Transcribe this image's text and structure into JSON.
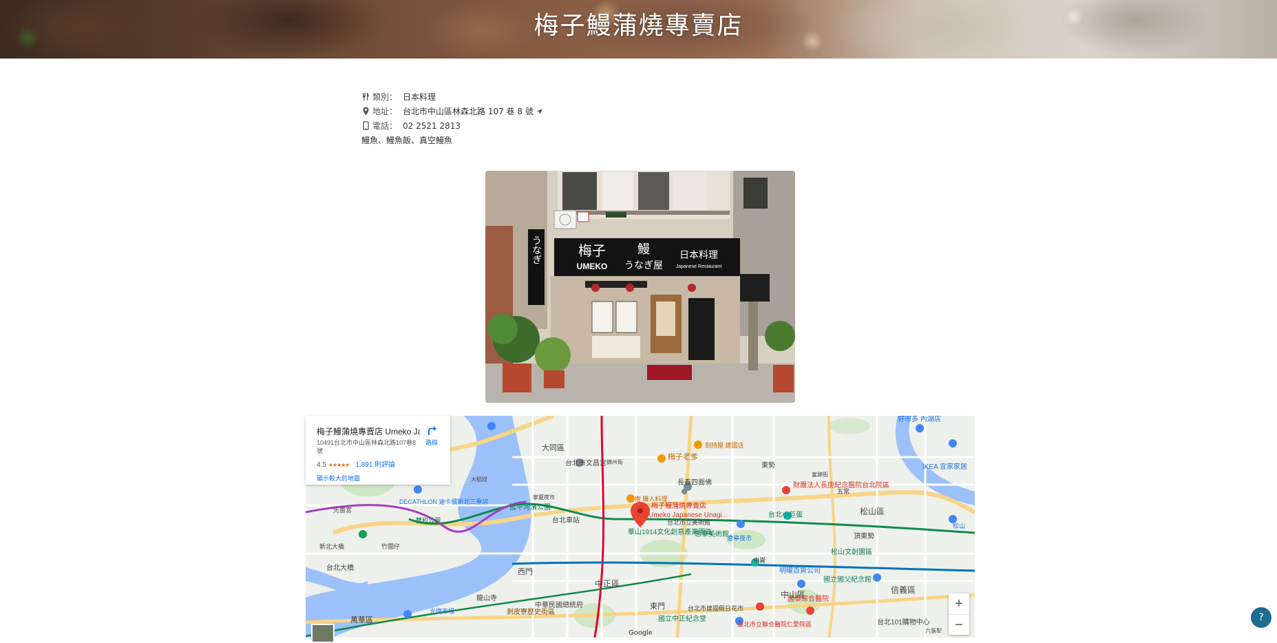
{
  "header": {
    "title": "梅子鰻蒲燒專賣店"
  },
  "info": {
    "category_label": "類別：",
    "category_value": "日本料理",
    "address_label": "地址：",
    "address_value": "台北市中山區林森北路 107 巷 8 號",
    "phone_label": "電話：",
    "phone_value": "02 2521 2813",
    "tags": "鰻魚、鰻魚飯、真空鰻魚"
  },
  "photo": {
    "sign_name_cn": "梅子",
    "sign_name_en": "UMEKO",
    "sign_eel": "鰻",
    "sign_unagiya": "うなぎ屋",
    "sign_cuisine": "日本料理",
    "sign_cuisine_en": "Japanese Restaurant",
    "side_sign": "うなぎ"
  },
  "map": {
    "place_name": "梅子鰻蒲燒專賣店 Umeko Jap...",
    "place_address": "10491台北市中山區林森北路107巷8號",
    "rating": "4.5",
    "stars": "★★★★★",
    "reviews": "1,891 則評論",
    "directions_label": "路線",
    "enlarge_link": "顯示較大的地圖",
    "pin_label_cn": "梅子鰻蒲燒專賣店",
    "pin_label_en": "Umeko Japanese Unagi...",
    "zoom_in": "+",
    "zoom_out": "−",
    "google": "Google",
    "labels": [
      "大同區",
      "中山區",
      "松山區",
      "信義區",
      "中正區",
      "萬華區",
      "東門",
      "西門",
      "台北市立美術館",
      "梅子老爹",
      "台北車站",
      "華山1914文化創意產業園區",
      "忠泰美術館",
      "台北小巨蛋",
      "遼寧夜市",
      "松山文創園區",
      "國立國父紀念館",
      "台北101購物中心",
      "明曜百貨公司",
      "國泰綜合醫院",
      "長春四面佛",
      "財團法人長庚紀念醫院台北院區",
      "DECATHLON 迪卡儂新北三重店",
      "台北大橋",
      "延平河濱公園",
      "台北市文昌宮",
      "國立中正紀念堂",
      "中華民國總統府",
      "龍山寺",
      "剝皮寮歷史街區",
      "頂東勢",
      "東勢",
      "五常",
      "IKEA 宜家家居",
      "好市多 內湖店",
      "錦州街",
      "大稻埕",
      "寧夏夜市",
      "先嗇宮",
      "新北大橋",
      "光復市場",
      "雙和公園",
      "竹圍仔",
      "台北市建國假日花市",
      "臺北市立聯合醫院仁愛院區",
      "松山",
      "富錦街",
      "中崙",
      "六張犁",
      "樹 職人料理",
      "劍持屋 建國店"
    ]
  },
  "help_button": "?"
}
